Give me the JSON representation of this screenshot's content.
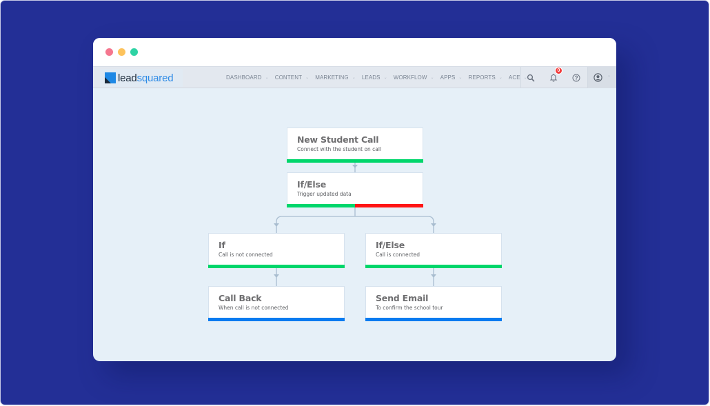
{
  "colors": {
    "backdrop": "#232f96",
    "window_dots": [
      "#f5778f",
      "#fdc35c",
      "#2ed3a4"
    ],
    "green": "#00d66b",
    "red": "#ff1414",
    "blue": "#0a7bf0",
    "connector": "#a9bdd0"
  },
  "navbar": {
    "logo": {
      "part1": "lead",
      "part2": "squared"
    },
    "menu": [
      {
        "label": "DASHBOARD"
      },
      {
        "label": "CONTENT"
      },
      {
        "label": "MARKETING"
      },
      {
        "label": "LEADS"
      },
      {
        "label": "WORKFLOW"
      },
      {
        "label": "APPS"
      },
      {
        "label": "REPORTS"
      },
      {
        "label": "ACE"
      }
    ],
    "chevron": "⌄",
    "icons": {
      "search": "search-icon",
      "notifications": "bell-icon",
      "help": "help-icon",
      "account": "user-avatar-icon"
    },
    "notification_count": "0"
  },
  "workflow": {
    "nodes": [
      {
        "id": "new-student-call",
        "title": "New Student Call",
        "subtitle": "Connect with the student on call",
        "bar": [
          "green"
        ]
      },
      {
        "id": "if-else-trigger",
        "title": "If/Else",
        "subtitle": "Trigger updated data",
        "bar": [
          "green",
          "red"
        ]
      },
      {
        "id": "if-not-connected",
        "title": "If",
        "subtitle": "Call is not connected",
        "bar": [
          "green"
        ]
      },
      {
        "id": "if-else-connected",
        "title": "If/Else",
        "subtitle": "Call is connected",
        "bar": [
          "green"
        ]
      },
      {
        "id": "call-back",
        "title": "Call Back",
        "subtitle": "When call is not connected",
        "bar": [
          "blue"
        ]
      },
      {
        "id": "send-email",
        "title": "Send Email",
        "subtitle": "To confirm the school tour",
        "bar": [
          "blue"
        ]
      }
    ]
  }
}
